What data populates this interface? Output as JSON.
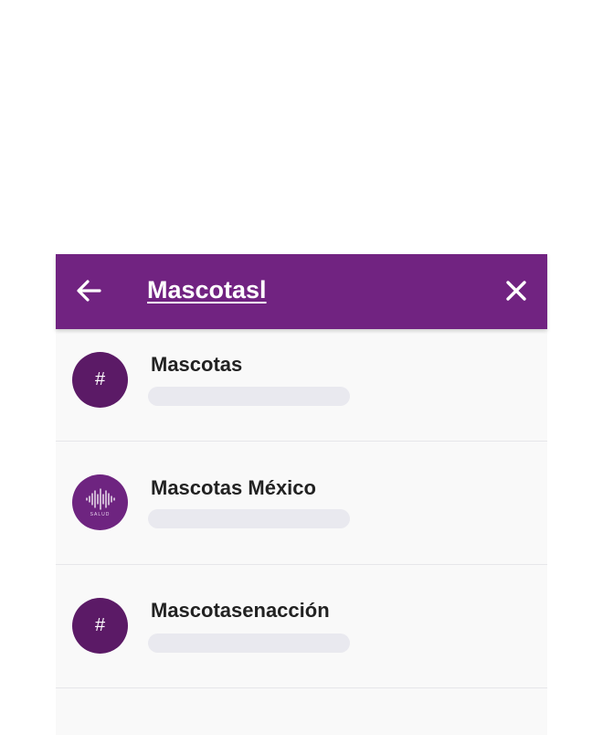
{
  "search": {
    "query": "Mascotasl",
    "back_icon": "arrow-left-icon",
    "clear_icon": "close-icon"
  },
  "results": [
    {
      "name": "Mascotas",
      "avatar_symbol": "#",
      "avatar_icon": "hash-icon"
    },
    {
      "name": "Mascotas México",
      "avatar_icon": "sound-wave-logo-icon",
      "avatar_caption": "SALUD"
    },
    {
      "name": "Mascotasenacción",
      "avatar_symbol": "#",
      "avatar_icon": "hash-icon"
    }
  ],
  "colors": {
    "header": "#712381",
    "avatar": "#5b1a66",
    "text": "#222222",
    "placeholder_line": "#e9e9ef",
    "background": "#f9f9f9"
  }
}
